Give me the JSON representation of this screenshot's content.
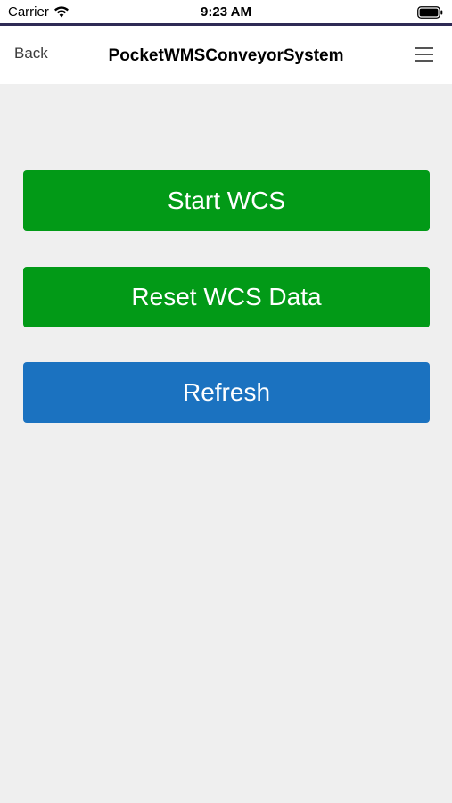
{
  "status_bar": {
    "carrier": "Carrier",
    "time": "9:23 AM",
    "wifi_icon": "wifi-icon",
    "battery_icon": "battery-icon"
  },
  "nav": {
    "back_label": "Back",
    "title": "PocketWMSConveyorSystem",
    "menu_icon": "hamburger-menu-icon"
  },
  "actions": {
    "start_label": "Start WCS",
    "reset_label": "Reset WCS Data",
    "refresh_label": "Refresh"
  },
  "colors": {
    "accent_purple": "#2f2a55",
    "green_button": "#029a17",
    "blue_button": "#1b72c0",
    "background": "#efefef"
  }
}
